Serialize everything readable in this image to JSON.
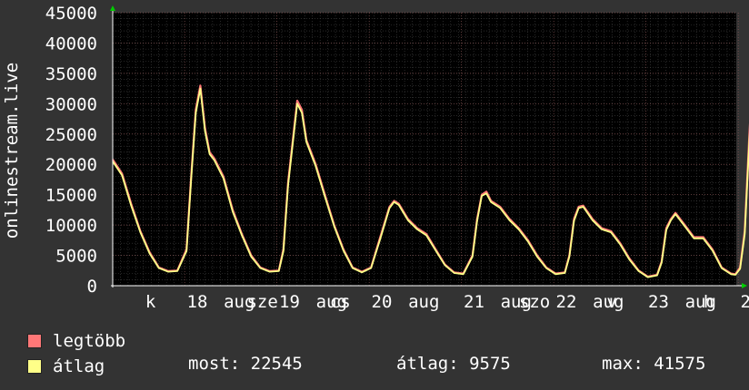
{
  "chart_data": {
    "type": "line",
    "ylabel": "onlinestream.live",
    "ylim": [
      0,
      45000
    ],
    "yticks": [
      0,
      5000,
      10000,
      15000,
      20000,
      25000,
      30000,
      35000,
      40000,
      45000
    ],
    "xlim": [
      0,
      8.0
    ],
    "xtick_labels": [
      {
        "x": 0.55,
        "text": "k"
      },
      {
        "x": 1.0,
        "text": "18"
      },
      {
        "x": 1.4,
        "text": "aug"
      },
      {
        "x": 1.65,
        "text": "sze"
      },
      {
        "x": 2.0,
        "text": "19"
      },
      {
        "x": 2.4,
        "text": "aug"
      },
      {
        "x": 2.55,
        "text": "cs"
      },
      {
        "x": 3.0,
        "text": "20"
      },
      {
        "x": 3.4,
        "text": "aug"
      },
      {
        "x": 4.0,
        "text": "21"
      },
      {
        "x": 4.4,
        "text": "aug"
      },
      {
        "x": 4.6,
        "text": "szo"
      },
      {
        "x": 5.0,
        "text": "22"
      },
      {
        "x": 5.4,
        "text": "aug"
      },
      {
        "x": 5.55,
        "text": "v"
      },
      {
        "x": 6.0,
        "text": "23"
      },
      {
        "x": 6.4,
        "text": "aug"
      },
      {
        "x": 6.6,
        "text": "h"
      },
      {
        "x": 7.0,
        "text": "24"
      },
      {
        "x": 7.4,
        "text": "a"
      }
    ],
    "series": [
      {
        "name": "legtöbb",
        "color": "#ff7777",
        "x": [
          0,
          0.1,
          0.2,
          0.3,
          0.4,
          0.5,
          0.6,
          0.7,
          0.8,
          0.85,
          0.9,
          0.95,
          1.0,
          1.05,
          1.1,
          1.2,
          1.3,
          1.4,
          1.5,
          1.6,
          1.7,
          1.8,
          1.85,
          1.9,
          2.0,
          2.05,
          2.1,
          2.2,
          2.3,
          2.4,
          2.5,
          2.6,
          2.7,
          2.8,
          2.9,
          3.0,
          3.05,
          3.1,
          3.2,
          3.3,
          3.4,
          3.5,
          3.6,
          3.7,
          3.8,
          3.9,
          3.95,
          4.0,
          4.05,
          4.1,
          4.2,
          4.3,
          4.4,
          4.5,
          4.6,
          4.7,
          4.8,
          4.9,
          4.95,
          5.0,
          5.05,
          5.1,
          5.2,
          5.3,
          5.4,
          5.5,
          5.6,
          5.7,
          5.8,
          5.9,
          5.95,
          6.0,
          6.05,
          6.1,
          6.2,
          6.3,
          6.4,
          6.5,
          6.6,
          6.7,
          6.75,
          6.8,
          6.85,
          6.9,
          6.95,
          7.0,
          7.05,
          7.1,
          7.15
        ],
        "values": [
          20800,
          18500,
          13500,
          9000,
          5500,
          3000,
          2400,
          2500,
          6000,
          18000,
          29000,
          33000,
          26000,
          22000,
          21000,
          18000,
          12500,
          8500,
          5000,
          3000,
          2400,
          2500,
          6000,
          17000,
          30500,
          29000,
          24000,
          20000,
          15000,
          10000,
          6000,
          3000,
          2300,
          3000,
          8000,
          13000,
          14000,
          13500,
          11000,
          9500,
          8500,
          6000,
          3500,
          2200,
          2000,
          5000,
          11000,
          15000,
          15500,
          14000,
          13000,
          11000,
          9500,
          7500,
          5000,
          3000,
          2000,
          2200,
          5000,
          11000,
          13000,
          13200,
          11000,
          9500,
          9000,
          7000,
          4500,
          2500,
          1500,
          1800,
          4000,
          9500,
          11000,
          12000,
          10000,
          8000,
          8000,
          6000,
          3000,
          2000,
          1900,
          3000,
          9000,
          25000,
          38000,
          42500,
          41000,
          27000,
          22500
        ]
      },
      {
        "name": "átlag",
        "color": "#ffff88",
        "x": [
          0,
          0.1,
          0.2,
          0.3,
          0.4,
          0.5,
          0.6,
          0.7,
          0.8,
          0.85,
          0.9,
          0.95,
          1.0,
          1.05,
          1.1,
          1.2,
          1.3,
          1.4,
          1.5,
          1.6,
          1.7,
          1.8,
          1.85,
          1.9,
          2.0,
          2.05,
          2.1,
          2.2,
          2.3,
          2.4,
          2.5,
          2.6,
          2.7,
          2.8,
          2.9,
          3.0,
          3.05,
          3.1,
          3.2,
          3.3,
          3.4,
          3.5,
          3.6,
          3.7,
          3.8,
          3.9,
          3.95,
          4.0,
          4.05,
          4.1,
          4.2,
          4.3,
          4.4,
          4.5,
          4.6,
          4.7,
          4.8,
          4.9,
          4.95,
          5.0,
          5.05,
          5.1,
          5.2,
          5.3,
          5.4,
          5.5,
          5.6,
          5.7,
          5.8,
          5.9,
          5.95,
          6.0,
          6.05,
          6.1,
          6.2,
          6.3,
          6.4,
          6.5,
          6.6,
          6.7,
          6.75,
          6.8,
          6.85,
          6.9,
          6.95,
          7.0,
          7.05,
          7.1,
          7.15
        ],
        "values": [
          20500,
          18200,
          13200,
          8800,
          5300,
          2900,
          2300,
          2400,
          5700,
          17500,
          28500,
          32500,
          25500,
          21700,
          20700,
          17700,
          12200,
          8300,
          4800,
          2900,
          2300,
          2400,
          5700,
          16500,
          30000,
          28500,
          23700,
          19700,
          14700,
          9800,
          5800,
          2900,
          2200,
          2900,
          7700,
          12800,
          13800,
          13300,
          10800,
          9300,
          8300,
          5800,
          3400,
          2100,
          1900,
          4800,
          10700,
          14800,
          15200,
          13800,
          12800,
          10800,
          9300,
          7300,
          4800,
          2900,
          1900,
          2100,
          4800,
          10700,
          12800,
          13000,
          10800,
          9300,
          8800,
          6800,
          4300,
          2400,
          1400,
          1700,
          3800,
          9200,
          10800,
          11800,
          9800,
          7800,
          7800,
          5800,
          2900,
          1900,
          1800,
          2800,
          8500,
          24000,
          36500,
          41500,
          40000,
          26500,
          22545
        ]
      }
    ],
    "grid": true
  },
  "legend": {
    "items": [
      {
        "label": "legtöbb",
        "color": "#ff7777"
      },
      {
        "label": "átlag",
        "color": "#ffff88"
      }
    ]
  },
  "stats": {
    "current": "most: 22545",
    "average": "átlag: 9575",
    "max": "max: 41575"
  }
}
